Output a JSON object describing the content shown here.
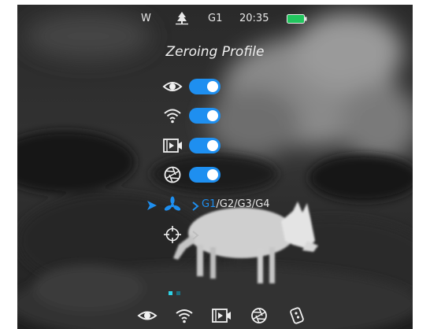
{
  "status_bar": {
    "wind": "W",
    "profile": "G1",
    "time": "20:35",
    "battery_color": "#22c55e"
  },
  "title": "Zeroing Profile",
  "settings": [
    {
      "icon": "eye-icon",
      "enabled": true
    },
    {
      "icon": "wifi-icon",
      "enabled": true
    },
    {
      "icon": "video-record-icon",
      "enabled": true
    },
    {
      "icon": "aperture-icon",
      "enabled": true
    }
  ],
  "profile_selector": {
    "icon": "fan-icon",
    "selected": "G1",
    "others": "/G2/G3/G4"
  },
  "reticle_row": {
    "icon": "crosshair-icon"
  },
  "bottom_bar": [
    "eye-icon",
    "wifi-icon",
    "video-record-icon",
    "aperture-icon",
    "remote-icon"
  ],
  "colors": {
    "accent": "#1e8ff0",
    "text": "#f0f0f0"
  }
}
